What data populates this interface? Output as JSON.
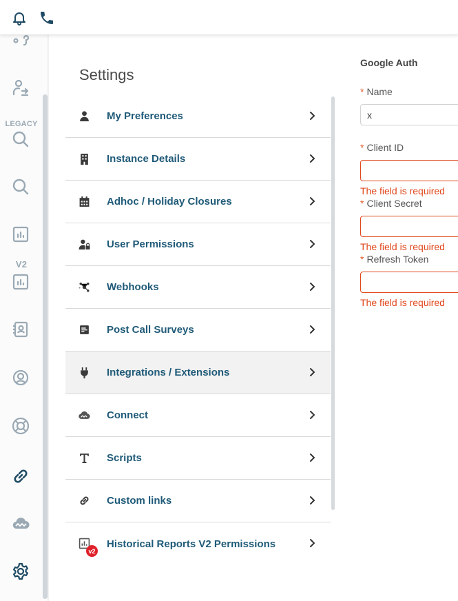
{
  "topbar": {
    "icons": [
      "bell-icon",
      "phone-icon"
    ]
  },
  "sidebar": {
    "legacy_label": "LEGACY",
    "v2_label": "V2",
    "icons": [
      "recordings-icon",
      "user-transfer-icon",
      "search-icon",
      "search-icon",
      "report-icon",
      "report-icon",
      "contacts-icon",
      "user-circle-icon",
      "lifebuoy-icon",
      "link-icon",
      "cloud-connect-icon",
      "gear-icon"
    ]
  },
  "settings": {
    "title": "Settings",
    "items": [
      {
        "label": "My Preferences",
        "icon": "person-icon"
      },
      {
        "label": "Instance Details",
        "icon": "building-icon"
      },
      {
        "label": "Adhoc / Holiday Closures",
        "icon": "calendar-icon"
      },
      {
        "label": "User Permissions",
        "icon": "user-lock-icon"
      },
      {
        "label": "Webhooks",
        "icon": "webhook-icon"
      },
      {
        "label": "Post Call Surveys",
        "icon": "survey-icon"
      },
      {
        "label": "Integrations / Extensions",
        "icon": "plug-icon"
      },
      {
        "label": "Connect",
        "icon": "cloud-icon"
      },
      {
        "label": "Scripts",
        "icon": "text-icon"
      },
      {
        "label": "Custom links",
        "icon": "link-icon"
      },
      {
        "label": "Historical Reports V2 Permissions",
        "icon": "report-icon",
        "badge": "v2"
      }
    ],
    "active_index": 6
  },
  "form": {
    "title": "Google Auth",
    "required_mark": "*",
    "fields": [
      {
        "label": "Name",
        "value": "x",
        "error": ""
      },
      {
        "label": "Client ID",
        "value": "",
        "error": "The field is required"
      },
      {
        "label": "Client Secret",
        "value": "",
        "error": "The field is required"
      },
      {
        "label": "Refresh Token",
        "value": "",
        "error": "The field is required"
      }
    ]
  },
  "colors": {
    "menu_text": "#1f5a78",
    "icon_dark": "#1e4a63",
    "sidebar_icon": "#9aa9b4",
    "error": "#e0471b",
    "required": "#e05a2b"
  }
}
